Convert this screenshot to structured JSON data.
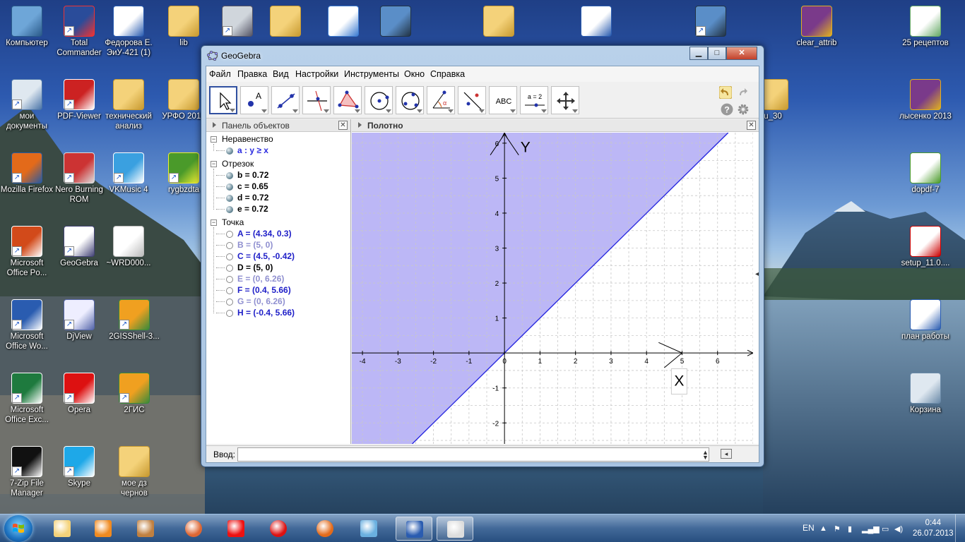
{
  "desktop": {
    "icons": [
      {
        "label": "Компьютер",
        "icon": "computer-icon"
      },
      {
        "label": "Total Commander",
        "icon": "floppy-icon"
      },
      {
        "label": "Федорова Е. ЭиУ-421 (1)",
        "icon": "word-doc-icon"
      },
      {
        "label": "lib",
        "icon": "folder-icon"
      },
      {
        "label": "",
        "icon": "lion-icon"
      },
      {
        "label": "",
        "icon": "folder-icon"
      },
      {
        "label": "",
        "icon": "mp3-icon"
      },
      {
        "label": "",
        "icon": "installer-icon"
      },
      {
        "label": "",
        "icon": "folder-icon"
      },
      {
        "label": "",
        "icon": "word-doc-icon"
      },
      {
        "label": "",
        "icon": "installer-icon"
      },
      {
        "label": "clear_attrib",
        "icon": "winrar-icon"
      },
      {
        "label": "25 рецептов",
        "icon": "document-icon"
      },
      {
        "label": "мои документы",
        "icon": "documents-icon"
      },
      {
        "label": "PDF-Viewer",
        "icon": "pdf-icon"
      },
      {
        "label": "технический анализ",
        "icon": "folder-icon"
      },
      {
        "label": "УРФО 2013",
        "icon": "folder-icon"
      },
      {
        "label": "лысенко 2013",
        "icon": "winrar-icon"
      },
      {
        "label": "Mozilla Firefox",
        "icon": "firefox-icon"
      },
      {
        "label": "Nero Burning ROM",
        "icon": "nero-icon"
      },
      {
        "label": "VKMusic 4",
        "icon": "vkmusic-icon"
      },
      {
        "label": "rygbzdta",
        "icon": "shield-icon"
      },
      {
        "label": "dopdf-7",
        "icon": "dopdf-icon"
      },
      {
        "label": "Microsoft Office Po...",
        "icon": "powerpoint-icon"
      },
      {
        "label": "GeoGebra",
        "icon": "geogebra-icon"
      },
      {
        "label": "~WRD000...",
        "icon": "blank-file-icon"
      },
      {
        "label": "setup_11.0....",
        "icon": "kaspersky-icon"
      },
      {
        "label": "Microsoft Office Wo...",
        "icon": "word-icon"
      },
      {
        "label": "DjView",
        "icon": "djview-icon"
      },
      {
        "label": "2GISShell-3...",
        "icon": "2gis-icon"
      },
      {
        "label": "план работы",
        "icon": "word-doc-icon"
      },
      {
        "label": "Microsoft Office Exc...",
        "icon": "excel-icon"
      },
      {
        "label": "Opera",
        "icon": "opera-icon"
      },
      {
        "label": "2ГИС",
        "icon": "2gis-icon"
      },
      {
        "label": "Корзина",
        "icon": "recycle-bin-icon"
      },
      {
        "label": "7-Zip File Manager",
        "icon": "7zip-icon"
      },
      {
        "label": "Skype",
        "icon": "skype-icon"
      },
      {
        "label": "мое дз чернов",
        "icon": "folder-icon"
      },
      {
        "label": "u_30",
        "icon": "folder-icon"
      }
    ]
  },
  "window": {
    "title": "GeoGebra",
    "buttons": {
      "minimize": "▁",
      "maximize": "□",
      "close": "✕"
    },
    "menu": [
      "Файл",
      "Правка",
      "Вид",
      "Настройки",
      "Инструменты",
      "Окно",
      "Справка"
    ],
    "tools": [
      "move-tool-icon",
      "point-tool-icon",
      "line-tool-icon",
      "perpendicular-tool-icon",
      "polygon-tool-icon",
      "circle-tool-icon",
      "conic-tool-icon",
      "angle-tool-icon",
      "reflect-tool-icon",
      "text-tool-icon",
      "slider-tool-icon",
      "move-view-tool-icon"
    ],
    "text_tool_label": "ABC",
    "slider_tool_label": "a = 2"
  },
  "algebra": {
    "title": "Панель объектов",
    "close": "✕",
    "groups": [
      {
        "name": "Неравенство",
        "items": [
          {
            "text": "a :  y ≥ x",
            "color": "#2a2ae0",
            "visible": true
          }
        ]
      },
      {
        "name": "Отрезок",
        "items": [
          {
            "text": "b = 0.72",
            "color": "#000000",
            "visible": true
          },
          {
            "text": "c = 0.65",
            "color": "#000000",
            "visible": true
          },
          {
            "text": "d = 0.72",
            "color": "#000000",
            "visible": true
          },
          {
            "text": "e = 0.72",
            "color": "#000000",
            "visible": true
          }
        ]
      },
      {
        "name": "Точка",
        "items": [
          {
            "text": "A = (4.34, 0.3)",
            "color": "#2020c8",
            "visible": false
          },
          {
            "text": "B = (5, 0)",
            "color": "#9090d0",
            "visible": false
          },
          {
            "text": "C = (4.5, -0.42)",
            "color": "#2020c8",
            "visible": false
          },
          {
            "text": "D = (5, 0)",
            "color": "#000000",
            "visible": false
          },
          {
            "text": "E = (0, 6.26)",
            "color": "#9090d0",
            "visible": false
          },
          {
            "text": "F = (0.4, 5.66)",
            "color": "#2020c8",
            "visible": false
          },
          {
            "text": "G = (0, 6.26)",
            "color": "#9090d0",
            "visible": false
          },
          {
            "text": "H = (-0.4, 5.66)",
            "color": "#2020c8",
            "visible": false
          }
        ]
      }
    ]
  },
  "graphics": {
    "title": "Полотно",
    "close": "✕",
    "axis_x_label": "X",
    "axis_y_label": "Y",
    "xlim": [
      -4.3,
      7.0
    ],
    "ylim": [
      -2.6,
      6.3
    ],
    "x_ticks": [
      -4,
      -3,
      -2,
      -1,
      0,
      1,
      2,
      3,
      4,
      5,
      6
    ],
    "y_ticks": [
      -2,
      -1,
      1,
      2,
      3,
      4,
      5,
      6
    ],
    "region_color": "#b0aaf4",
    "line_color": "#2a2ae0",
    "inequality": "y ≥ x"
  },
  "inputbar": {
    "label": "Ввод:",
    "value": ""
  },
  "taskbar": {
    "apps": [
      "explorer-icon",
      "media-player-icon",
      "agent-icon",
      "chrome-icon",
      "yandex-icon",
      "opera-icon",
      "firefox-icon",
      "speaker-icon",
      "word-icon",
      "geogebra-icon"
    ],
    "open": [
      "word-icon",
      "geogebra-icon"
    ],
    "lang": "EN",
    "time": "0:44",
    "date": "26.07.2013"
  }
}
